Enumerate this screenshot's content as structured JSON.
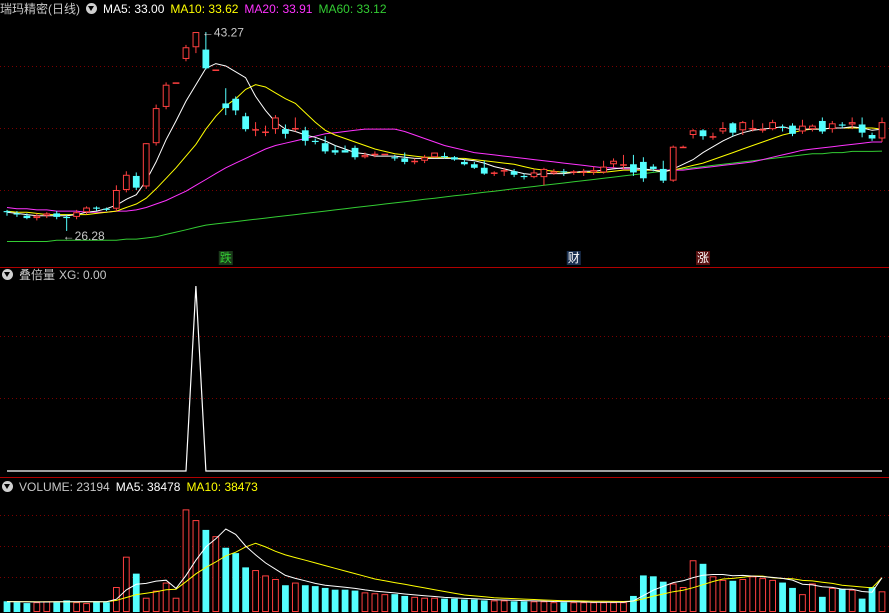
{
  "main": {
    "title": "瑞玛精密(日线)",
    "ma_labels": [
      {
        "text": "MA5: 33.00",
        "color": "#ffffff"
      },
      {
        "text": "MA10: 33.62",
        "color": "#ffff00"
      },
      {
        "text": "MA20: 33.91",
        "color": "#ff33ff"
      },
      {
        "text": "MA60: 33.12",
        "color": "#33cc33"
      }
    ],
    "high_label": "43.27",
    "low_label": "26.28",
    "markers": [
      {
        "text": "跌",
        "color": "#33cc33",
        "bg": "#1a3a1a"
      },
      {
        "text": "财",
        "color": "#ffffff",
        "bg": "#1a3050"
      },
      {
        "text": "涨",
        "color": "#ffffff",
        "bg": "#5a1010"
      }
    ]
  },
  "indicator": {
    "title": "叠倍量",
    "value_label": "XG: 0.00"
  },
  "volume": {
    "title": "VOLUME: 23194",
    "ma5_label": "MA5: 38478",
    "ma10_label": "MA10: 38473",
    "ma10_color": "#ffff00"
  },
  "chart_data": {
    "type": "candlestick",
    "ylim": [
      24.5,
      44.5
    ],
    "up_color": "#ff4040",
    "down_color": "#54ffff",
    "candles": [
      [
        28.0,
        27.9,
        28.1,
        27.6
      ],
      [
        27.8,
        27.7,
        28.0,
        27.5
      ],
      [
        27.6,
        27.4,
        27.8,
        27.3
      ],
      [
        27.4,
        27.6,
        27.8,
        27.2
      ],
      [
        27.6,
        27.8,
        27.9,
        27.4
      ],
      [
        27.8,
        27.5,
        28.0,
        27.3
      ],
      [
        27.5,
        27.4,
        27.7,
        26.3
      ],
      [
        27.5,
        27.9,
        28.1,
        27.3
      ],
      [
        27.9,
        28.3,
        28.4,
        27.7
      ],
      [
        28.3,
        28.2,
        28.4,
        28.0
      ],
      [
        28.2,
        28.1,
        28.3,
        28.0
      ],
      [
        28.2,
        29.8,
        30.2,
        28.0
      ],
      [
        29.8,
        31.1,
        31.4,
        29.6
      ],
      [
        31.0,
        30.0,
        31.3,
        29.8
      ],
      [
        30.1,
        33.8,
        33.8,
        29.9
      ],
      [
        33.8,
        36.8,
        37.1,
        33.6
      ],
      [
        36.9,
        38.8,
        39.0,
        36.7
      ],
      [
        39.0,
        39.0,
        39.0,
        39.0
      ],
      [
        41.0,
        42.0,
        42.2,
        40.8
      ],
      [
        42.0,
        43.3,
        43.3,
        41.5
      ],
      [
        41.8,
        40.2,
        43.3,
        40.1
      ],
      [
        40.1,
        40.1,
        40.1,
        40.1
      ],
      [
        37.2,
        36.8,
        38.5,
        36.2
      ],
      [
        37.6,
        36.6,
        37.8,
        36.2
      ],
      [
        36.1,
        35.0,
        36.4,
        34.8
      ],
      [
        35.0,
        35.0,
        35.6,
        34.4
      ],
      [
        34.8,
        34.8,
        35.3,
        34.4
      ],
      [
        35.0,
        36.0,
        36.2,
        34.6
      ],
      [
        35.0,
        34.6,
        35.4,
        34.2
      ],
      [
        35.0,
        35.1,
        36.0,
        34.8
      ],
      [
        34.9,
        34.0,
        35.2,
        33.6
      ],
      [
        34.0,
        33.9,
        34.2,
        33.7
      ],
      [
        33.8,
        33.1,
        34.4,
        32.9
      ],
      [
        33.2,
        33.0,
        33.6,
        32.8
      ],
      [
        33.2,
        33.0,
        33.6,
        33.0
      ],
      [
        33.4,
        32.6,
        33.6,
        32.4
      ],
      [
        32.6,
        32.8,
        33.0,
        32.5
      ],
      [
        32.8,
        32.9,
        33.1,
        32.6
      ],
      [
        32.9,
        32.9,
        32.9,
        32.9
      ],
      [
        32.6,
        32.5,
        32.8,
        32.3
      ],
      [
        32.5,
        32.2,
        33.0,
        32.0
      ],
      [
        32.2,
        32.3,
        32.5,
        32.0
      ],
      [
        32.3,
        32.6,
        32.8,
        32.1
      ],
      [
        32.6,
        33.0,
        33.0,
        32.6
      ],
      [
        32.7,
        32.6,
        33.0,
        32.5
      ],
      [
        32.6,
        32.4,
        32.7,
        32.3
      ],
      [
        32.2,
        32.0,
        32.4,
        31.9
      ],
      [
        32.0,
        31.7,
        32.2,
        31.6
      ],
      [
        31.7,
        31.2,
        32.3,
        31.1
      ],
      [
        31.2,
        31.3,
        31.4,
        31.0
      ],
      [
        31.5,
        31.5,
        31.7,
        31.0
      ],
      [
        31.4,
        31.1,
        31.6,
        30.9
      ],
      [
        31.0,
        30.9,
        31.2,
        30.7
      ],
      [
        30.9,
        31.3,
        31.6,
        30.8
      ],
      [
        30.9,
        31.6,
        31.7,
        30.2
      ],
      [
        31.2,
        31.4,
        31.6,
        31.1
      ],
      [
        31.4,
        31.3,
        31.6,
        31.0
      ],
      [
        31.3,
        31.4,
        31.5,
        31.1
      ],
      [
        31.3,
        31.4,
        31.6,
        31.0
      ],
      [
        31.3,
        31.5,
        31.8,
        31.1
      ],
      [
        31.3,
        31.8,
        32.3,
        31.2
      ],
      [
        32.0,
        32.3,
        32.5,
        31.7
      ],
      [
        32.0,
        32.0,
        32.8,
        31.6
      ],
      [
        32.0,
        31.3,
        32.8,
        31.0
      ],
      [
        32.2,
        30.8,
        32.6,
        30.5
      ],
      [
        31.8,
        31.6,
        32.0,
        31.4
      ],
      [
        31.6,
        30.6,
        32.3,
        30.4
      ],
      [
        30.6,
        33.5,
        33.6,
        30.5
      ],
      [
        33.5,
        33.5,
        33.6,
        33.4
      ],
      [
        34.5,
        34.9,
        35.0,
        34.2
      ],
      [
        34.9,
        34.4,
        35.0,
        34.1
      ],
      [
        34.4,
        34.4,
        34.7,
        34.1
      ],
      [
        34.8,
        35.1,
        35.6,
        34.6
      ],
      [
        35.5,
        34.7,
        35.6,
        34.4
      ],
      [
        34.9,
        35.6,
        35.7,
        34.5
      ],
      [
        35.0,
        35.1,
        35.8,
        34.8
      ],
      [
        35.0,
        35.0,
        35.5,
        34.7
      ],
      [
        35.0,
        35.6,
        35.8,
        34.9
      ],
      [
        35.2,
        35.1,
        35.4,
        34.8
      ],
      [
        35.3,
        34.6,
        35.5,
        34.4
      ],
      [
        34.8,
        35.3,
        35.8,
        34.6
      ],
      [
        35.0,
        35.3,
        35.4,
        34.8
      ],
      [
        35.7,
        34.8,
        36.0,
        34.6
      ],
      [
        35.0,
        35.5,
        35.7,
        34.7
      ],
      [
        35.4,
        35.3,
        35.6,
        35.1
      ],
      [
        35.4,
        35.6,
        36.0,
        35.0
      ],
      [
        35.4,
        34.7,
        36.0,
        34.3
      ],
      [
        34.5,
        34.2,
        34.7,
        34.0
      ],
      [
        34.2,
        35.6,
        36.0,
        33.9
      ]
    ],
    "ma5": [
      27.9,
      27.8,
      27.7,
      27.6,
      27.6,
      27.6,
      27.6,
      27.7,
      27.9,
      28.0,
      28.2,
      28.5,
      29.0,
      29.4,
      30.6,
      32.2,
      34.1,
      35.7,
      37.4,
      38.8,
      40.2,
      40.6,
      40.4,
      39.9,
      39.4,
      37.8,
      36.6,
      35.6,
      35.0,
      34.8,
      34.5,
      34.3,
      34.0,
      33.6,
      33.3,
      33.0,
      32.9,
      32.7,
      32.7,
      32.7,
      32.6,
      32.5,
      32.5,
      32.5,
      32.5,
      32.5,
      32.4,
      32.3,
      32.1,
      31.8,
      31.6,
      31.4,
      31.2,
      31.1,
      31.2,
      31.2,
      31.2,
      31.3,
      31.4,
      31.4,
      31.5,
      31.6,
      31.7,
      31.7,
      31.6,
      31.5,
      31.3,
      31.6,
      32.0,
      32.4,
      33.0,
      33.5,
      34.0,
      34.4,
      34.7,
      34.9,
      35.0,
      35.1,
      35.2,
      35.0,
      35.0,
      35.0,
      35.0,
      35.1,
      35.1,
      35.2,
      35.1,
      34.9,
      35.0
    ],
    "ma10": [
      28.0,
      27.9,
      27.9,
      27.8,
      27.7,
      27.7,
      27.7,
      27.7,
      27.7,
      27.8,
      27.9,
      28.0,
      28.3,
      28.6,
      29.1,
      29.9,
      30.8,
      31.7,
      32.7,
      33.7,
      35.0,
      36.1,
      37.0,
      37.6,
      38.4,
      38.8,
      38.6,
      38.1,
      37.6,
      37.2,
      36.4,
      35.6,
      34.9,
      34.5,
      34.2,
      33.9,
      33.6,
      33.3,
      33.1,
      32.9,
      32.8,
      32.7,
      32.6,
      32.6,
      32.6,
      32.5,
      32.5,
      32.4,
      32.3,
      32.2,
      32.1,
      32.0,
      31.8,
      31.6,
      31.5,
      31.4,
      31.3,
      31.3,
      31.3,
      31.3,
      31.3,
      31.4,
      31.5,
      31.5,
      31.5,
      31.5,
      31.4,
      31.5,
      31.7,
      31.9,
      32.1,
      32.4,
      32.7,
      33.0,
      33.3,
      33.6,
      33.9,
      34.2,
      34.5,
      34.7,
      34.9,
      35.0,
      35.0,
      35.1,
      35.1,
      35.1,
      35.1,
      35.1,
      35.0
    ],
    "ma20": [
      28.3,
      28.2,
      28.2,
      28.1,
      28.1,
      28.0,
      28.0,
      28.0,
      27.9,
      27.9,
      27.9,
      28.0,
      28.0,
      28.1,
      28.3,
      28.6,
      28.9,
      29.3,
      29.7,
      30.2,
      30.7,
      31.2,
      31.7,
      32.1,
      32.5,
      32.9,
      33.3,
      33.6,
      33.8,
      34.0,
      34.2,
      34.4,
      34.6,
      34.7,
      34.8,
      34.9,
      35.0,
      35.0,
      35.0,
      35.0,
      34.8,
      34.5,
      34.2,
      33.9,
      33.6,
      33.4,
      33.2,
      33.0,
      32.9,
      32.8,
      32.7,
      32.6,
      32.5,
      32.4,
      32.3,
      32.2,
      32.1,
      32.0,
      31.9,
      31.8,
      31.7,
      31.7,
      31.6,
      31.6,
      31.5,
      31.5,
      31.5,
      31.5,
      31.5,
      31.6,
      31.7,
      31.8,
      31.9,
      32.0,
      32.1,
      32.2,
      32.4,
      32.6,
      32.8,
      33.0,
      33.2,
      33.3,
      33.4,
      33.5,
      33.6,
      33.7,
      33.8,
      33.9,
      33.9
    ],
    "ma60": [
      25.4,
      25.4,
      25.4,
      25.4,
      25.4,
      25.5,
      25.5,
      25.5,
      25.5,
      25.5,
      25.5,
      25.5,
      25.6,
      25.6,
      25.7,
      25.8,
      26.0,
      26.2,
      26.4,
      26.6,
      26.8,
      26.9,
      27.0,
      27.1,
      27.2,
      27.3,
      27.4,
      27.5,
      27.6,
      27.7,
      27.8,
      27.9,
      28.0,
      28.1,
      28.2,
      28.3,
      28.4,
      28.5,
      28.6,
      28.7,
      28.8,
      28.9,
      29.0,
      29.1,
      29.2,
      29.3,
      29.4,
      29.5,
      29.6,
      29.7,
      29.8,
      29.9,
      30.0,
      30.1,
      30.2,
      30.3,
      30.4,
      30.5,
      30.6,
      30.7,
      30.8,
      30.9,
      31.0,
      31.1,
      31.2,
      31.3,
      31.4,
      31.5,
      31.6,
      31.7,
      31.8,
      31.9,
      32.0,
      32.1,
      32.2,
      32.3,
      32.4,
      32.5,
      32.6,
      32.7,
      32.8,
      32.9,
      32.9,
      33.0,
      33.0,
      33.1,
      33.1,
      33.1,
      33.12
    ],
    "indicator": {
      "ylim": [
        0,
        1
      ],
      "values": [
        0,
        0,
        0,
        0,
        0,
        0,
        0,
        0,
        0,
        0,
        0,
        0,
        0,
        0,
        0,
        0,
        0,
        0,
        0,
        1,
        0,
        0,
        0,
        0,
        0,
        0,
        0,
        0,
        0,
        0,
        0,
        0,
        0,
        0,
        0,
        0,
        0,
        0,
        0,
        0,
        0,
        0,
        0,
        0,
        0,
        0,
        0,
        0,
        0,
        0,
        0,
        0,
        0,
        0,
        0,
        0,
        0,
        0,
        0,
        0,
        0,
        0,
        0,
        0,
        0,
        0,
        0,
        0,
        0,
        0,
        0,
        0,
        0,
        0,
        0,
        0,
        0,
        0,
        0,
        0,
        0,
        0,
        0,
        0,
        0,
        0,
        0,
        0,
        0
      ]
    },
    "volume_data": {
      "ylim": [
        0,
        130000
      ],
      "values": [
        12000,
        11000,
        10000,
        11000,
        12000,
        11000,
        13000,
        11000,
        10000,
        12000,
        11000,
        28000,
        62000,
        43000,
        16000,
        24000,
        33000,
        16000,
        115000,
        103000,
        92000,
        85000,
        72000,
        66000,
        50000,
        47000,
        41000,
        37000,
        30000,
        33000,
        30000,
        29000,
        27000,
        25000,
        25000,
        24000,
        22000,
        21000,
        20000,
        20000,
        18000,
        17000,
        16000,
        16000,
        15000,
        15000,
        14000,
        14000,
        13000,
        13000,
        13000,
        12000,
        12000,
        12000,
        12000,
        11000,
        11000,
        11000,
        11000,
        11000,
        11000,
        11000,
        11000,
        18000,
        41000,
        40000,
        34000,
        32000,
        28000,
        58000,
        54000,
        40000,
        36000,
        35000,
        37000,
        40000,
        38000,
        36000,
        33000,
        27000,
        20000,
        32000,
        17000,
        27000,
        26000,
        25000,
        15000,
        28000,
        23194
      ],
      "ma5": [
        11500,
        11400,
        11300,
        11200,
        11200,
        11400,
        11500,
        11500,
        11700,
        11400,
        11500,
        14400,
        24800,
        31000,
        32000,
        34600,
        35600,
        26400,
        41000,
        58000,
        73000,
        82000,
        93000,
        87000,
        74000,
        64000,
        55000,
        48000,
        41000,
        37600,
        35000,
        32000,
        30000,
        28800,
        27800,
        26400,
        24800,
        23400,
        22400,
        21400,
        20200,
        19200,
        18200,
        17400,
        16400,
        15800,
        15200,
        14800,
        14200,
        13800,
        13400,
        13200,
        12800,
        12400,
        12200,
        11800,
        11600,
        11400,
        11200,
        11000,
        11000,
        11000,
        11000,
        12400,
        18400,
        24400,
        28800,
        33000,
        35000,
        38600,
        41200,
        42000,
        42000,
        40600,
        41000,
        40200,
        39400,
        38800,
        37600,
        35800,
        31200,
        30400,
        28400,
        27600,
        25400,
        25600,
        23000,
        22200,
        38478
      ],
      "ma10": [
        11800,
        11700,
        11600,
        11500,
        11400,
        11400,
        11400,
        11300,
        11400,
        11400,
        11500,
        13000,
        16300,
        19500,
        21000,
        22600,
        25000,
        25600,
        34000,
        42800,
        50000,
        56000,
        63000,
        67000,
        73000,
        77000,
        73000,
        68000,
        64000,
        61000,
        58000,
        55000,
        52000,
        49000,
        46000,
        43000,
        40000,
        37000,
        35000,
        33000,
        31000,
        29000,
        27000,
        25000,
        23000,
        21000,
        19000,
        18000,
        17000,
        16000,
        15500,
        15000,
        14500,
        14000,
        13500,
        13000,
        12700,
        12500,
        12300,
        12100,
        12000,
        11900,
        11800,
        12200,
        14800,
        17800,
        20200,
        22800,
        24400,
        27200,
        30600,
        34200,
        37000,
        37600,
        39000,
        40400,
        40200,
        38400,
        37500,
        37200,
        35400,
        34800,
        33400,
        32000,
        30000,
        29000,
        28000,
        27000,
        38473
      ]
    }
  }
}
